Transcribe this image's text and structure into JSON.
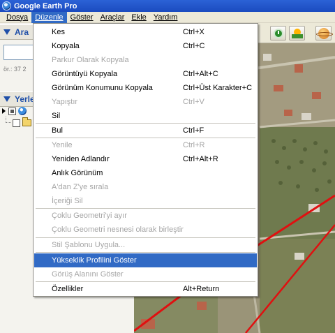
{
  "window": {
    "title": "Google Earth Pro"
  },
  "menubar": {
    "items": [
      {
        "label": "Dosya"
      },
      {
        "label": "Düzenle"
      },
      {
        "label": "Göster"
      },
      {
        "label": "Araçlar"
      },
      {
        "label": "Ekle"
      },
      {
        "label": "Yardım"
      }
    ],
    "active_index": 1
  },
  "left_panel": {
    "search_header": "Ara",
    "search_example": "ör.: 37 2",
    "places_header": "Yerle"
  },
  "edit_menu": {
    "items": [
      {
        "label": "Kes",
        "shortcut": "Ctrl+X",
        "enabled": true
      },
      {
        "label": "Kopyala",
        "shortcut": "Ctrl+C",
        "enabled": true
      },
      {
        "label": "Parkur Olarak Kopyala",
        "shortcut": "",
        "enabled": false
      },
      {
        "label": "Görüntüyü Kopyala",
        "shortcut": "Ctrl+Alt+C",
        "enabled": true
      },
      {
        "label": "Görünüm Konumunu Kopyala",
        "shortcut": "Ctrl+Üst Karakter+C",
        "enabled": true
      },
      {
        "label": "Yapıştır",
        "shortcut": "Ctrl+V",
        "enabled": false
      },
      {
        "label": "Sil",
        "shortcut": "",
        "enabled": true
      },
      {
        "label": "Bul",
        "shortcut": "Ctrl+F",
        "enabled": true
      },
      {
        "label": "Yenile",
        "shortcut": "Ctrl+R",
        "enabled": false
      },
      {
        "label": "Yeniden Adlandır",
        "shortcut": "Ctrl+Alt+R",
        "enabled": true
      },
      {
        "label": "Anlık Görünüm",
        "shortcut": "",
        "enabled": true
      },
      {
        "label": "A'dan Z'ye sırala",
        "shortcut": "",
        "enabled": false
      },
      {
        "label": "İçeriği Sil",
        "shortcut": "",
        "enabled": false
      },
      {
        "label": "Çoklu Geometri'yi ayır",
        "shortcut": "",
        "enabled": false
      },
      {
        "label": "Çoklu Geometri nesnesi olarak birleştir",
        "shortcut": "",
        "enabled": false
      },
      {
        "label": "Stil Şablonu Uygula...",
        "shortcut": "",
        "enabled": false
      },
      {
        "label": "Yükseklik Profilini Göster",
        "shortcut": "",
        "enabled": true,
        "highlighted": true
      },
      {
        "label": "Görüş Alanını Göster",
        "shortcut": "",
        "enabled": false
      },
      {
        "label": "Özellikler",
        "shortcut": "Alt+Return",
        "enabled": true
      }
    ]
  },
  "colors": {
    "title_bar": "#1b4bbf",
    "menu_highlight": "#316ac5",
    "disabled_text": "#a5a5a5",
    "panel_header_text": "#1f4fa8",
    "map_road": "#e01010"
  },
  "toolbar": {
    "icons": [
      "clock-icon",
      "sun-icon",
      "planet-icon"
    ]
  }
}
